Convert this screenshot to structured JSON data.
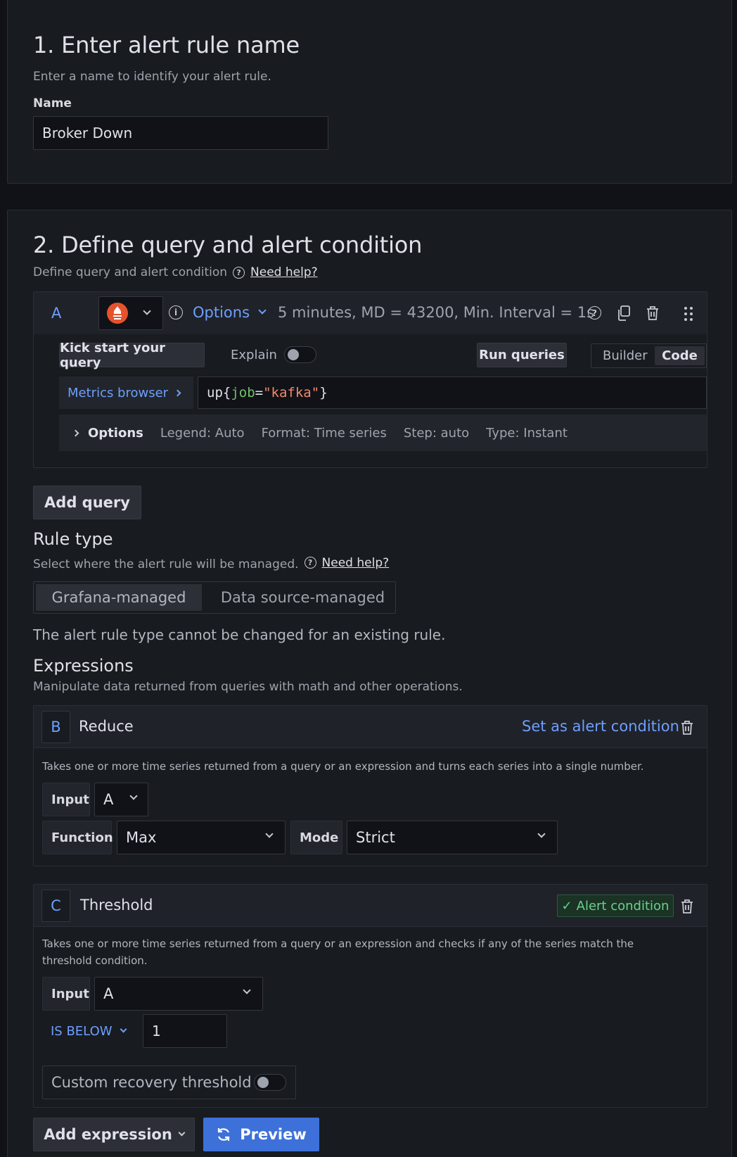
{
  "section1": {
    "title": "1. Enter alert rule name",
    "subtitle": "Enter a name to identify your alert rule.",
    "name_label": "Name",
    "name_value": "Broker Down"
  },
  "section2": {
    "title": "2. Define query and alert condition",
    "subtitle": "Define query and alert condition",
    "help_link": "Need help?",
    "query": {
      "ref": "A",
      "options_label": "Options",
      "options_summary": "5 minutes, MD = 43200, Min. Interval = 1s",
      "kick_start": "Kick start your query",
      "explain": "Explain",
      "run_queries": "Run queries",
      "mode_builder": "Builder",
      "mode_code": "Code",
      "metrics_browser": "Metrics browser",
      "expr_metric": "up{",
      "expr_key": "job",
      "expr_eq": "=",
      "expr_val": "\"kafka\"",
      "expr_close": "}",
      "opts_label": "Options",
      "opt_legend": "Legend: Auto",
      "opt_format": "Format: Time series",
      "opt_step": "Step: auto",
      "opt_type": "Type: Instant"
    },
    "add_query": "Add query",
    "rule_type": {
      "title": "Rule type",
      "subtitle": "Select where the alert rule will be managed.",
      "help_link": "Need help?",
      "opt_grafana": "Grafana-managed",
      "opt_datasource": "Data source-managed",
      "note": "The alert rule type cannot be changed for an existing rule."
    },
    "expressions": {
      "title": "Expressions",
      "subtitle": "Manipulate data returned from queries with math and other operations.",
      "reduce": {
        "ref": "B",
        "name": "Reduce",
        "set_condition": "Set as alert condition",
        "description": "Takes one or more time series returned from a query or an expression and turns each series into a single number.",
        "input_label": "Input",
        "input_value": "A",
        "function_label": "Function",
        "function_value": "Max",
        "mode_label": "Mode",
        "mode_value": "Strict"
      },
      "threshold": {
        "ref": "C",
        "name": "Threshold",
        "alert_condition": "Alert condition",
        "description": "Takes one or more time series returned from a query or an expression and checks if any of the series match the threshold condition.",
        "input_label": "Input",
        "input_value": "A",
        "operator": "IS BELOW",
        "value": "1",
        "recovery": "Custom recovery threshold"
      }
    },
    "add_expression": "Add expression",
    "preview": "Preview"
  },
  "colors": {
    "accent": "#3d71d9",
    "link_blue": "#6e9fff",
    "success": "#6ccf8e"
  }
}
